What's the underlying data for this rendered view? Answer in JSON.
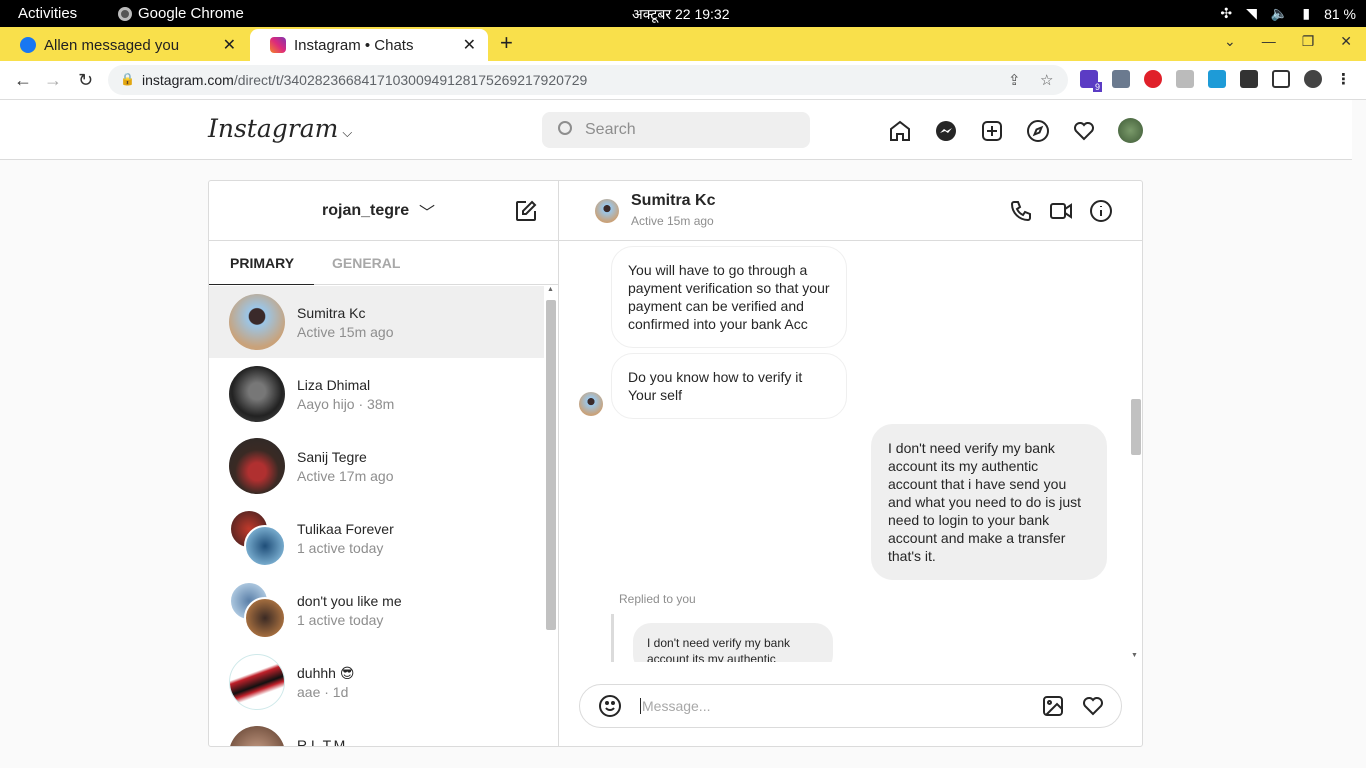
{
  "system": {
    "activities": "Activities",
    "app": "Google Chrome",
    "clock": "अक्टूबर 22  19:32",
    "battery": "81 %"
  },
  "browser": {
    "tabs": [
      {
        "label": "Allen messaged you",
        "favicon": "facebook-icon",
        "color": "#1877f2"
      },
      {
        "label": "Instagram • Chats",
        "favicon": "instagram-icon",
        "color": "#d6249f"
      }
    ],
    "url_host": "instagram.com",
    "url_path": "/direct/t/340282366841710300949128175269217920729",
    "extension_badge": "9"
  },
  "instagram": {
    "logo": "Instagram",
    "search_placeholder": "Search",
    "account": "rojan_tegre",
    "tab_primary": "PRIMARY",
    "tab_general": "GENERAL",
    "threads": [
      {
        "name": "Sumitra Kc",
        "sub": "Active 15m ago",
        "selected": true
      },
      {
        "name": "Liza Dhimal",
        "sub": "Aayo hijo · 38m"
      },
      {
        "name": "Sanij Tegre",
        "sub": "Active 17m ago"
      },
      {
        "name": "Tulikaa Forever",
        "sub": "1 active today"
      },
      {
        "name": "don't you like me",
        "sub": "1 active today"
      },
      {
        "name": "duhhh 😎",
        "sub": "aae · 1d"
      },
      {
        "name": "R.L.T.M.",
        "sub": ""
      }
    ],
    "chat": {
      "name": "Sumitra Kc",
      "status": "Active 15m ago",
      "messages": [
        {
          "text": "You will have to go through a payment verification so that your payment can be verified and confirmed into your bank Acc",
          "mine": false
        },
        {
          "text": "Do you know how to verify it Your self",
          "mine": false
        },
        {
          "text": "I don't need verify my bank account its my authentic account that i have send you and what you need to do is just need to login to your bank account and make a transfer that's it.",
          "mine": true
        }
      ],
      "replied_label": "Replied to you",
      "reply_preview": "I don't need verify my bank account its my authentic",
      "message_placeholder": "Message..."
    }
  }
}
